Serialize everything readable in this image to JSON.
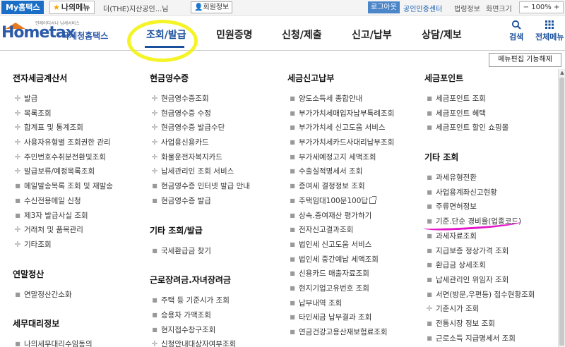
{
  "topbar": {
    "my_home": "My홈택스",
    "my_menu": "나의메뉴",
    "user_name": "더(THE)지산공인...님",
    "member_info": "회원정보",
    "logout": "로그아웃",
    "cert_center": "공인인증센터",
    "law_info": "법령정보",
    "screen_size": "화면크기",
    "zoom": "100%"
  },
  "header": {
    "logo_small": "언제어디서나 납세서비스",
    "logo_main": "Hometax",
    "logo_kr": "국세청홈택스",
    "nav": [
      "조회/발급",
      "민원증명",
      "신청/제출",
      "신고/납부",
      "상담/제보"
    ],
    "active_nav": "조회/발급",
    "search_label": "검색",
    "all_menu_label": "전체메뉴"
  },
  "menu_edit_label": "메뉴편집 기능해제",
  "columns": {
    "c1": {
      "sections": [
        {
          "title": "전자세금계산서",
          "items": [
            {
              "label": "발급",
              "mk": "plus"
            },
            {
              "label": "목록조회",
              "mk": "plus"
            },
            {
              "label": "합계표 및 통계조회",
              "mk": "plus"
            },
            {
              "label": "사용자유형별 조회권한 관리",
              "mk": "plus"
            },
            {
              "label": "주민번호수취분전환및조회",
              "mk": "plus"
            },
            {
              "label": "발급보류/예정목록조회",
              "mk": "plus"
            },
            {
              "label": "메일발송목록 조회 및 재발송",
              "mk": "sq"
            },
            {
              "label": "수신전용메일 신청",
              "mk": "sq"
            },
            {
              "label": "제3자 발급사실 조회",
              "mk": "sq"
            },
            {
              "label": "거래처 및 품목관리",
              "mk": "plus"
            },
            {
              "label": "기타조회",
              "mk": "plus"
            }
          ]
        },
        {
          "title": "연말정산",
          "items": [
            {
              "label": "연말정산간소화",
              "mk": "sq"
            }
          ]
        },
        {
          "title": "세무대리정보",
          "items": [
            {
              "label": "나의세무대리수임동의",
              "mk": "sq"
            }
          ]
        }
      ]
    },
    "c2": {
      "sections": [
        {
          "title": "현금영수증",
          "items": [
            {
              "label": "현금영수증조회",
              "mk": "plus"
            },
            {
              "label": "현금영수증 수정",
              "mk": "plus"
            },
            {
              "label": "현금영수증 발급수단",
              "mk": "plus"
            },
            {
              "label": "사업용신용카드",
              "mk": "plus"
            },
            {
              "label": "화물운전자복지카드",
              "mk": "plus"
            },
            {
              "label": "납세관리인 조회 서비스",
              "mk": "plus"
            },
            {
              "label": "현금영수증 인터넷 발급 안내",
              "mk": "sq"
            },
            {
              "label": "현금영수증 발급",
              "mk": "sq"
            }
          ]
        },
        {
          "title": "기타 조회/발급",
          "items": [
            {
              "label": "국세환급금 찾기",
              "mk": "sq"
            }
          ]
        },
        {
          "title": "근로장려금.자녀장려금",
          "items": [
            {
              "label": "주택 등 기준시가 조회",
              "mk": "sq"
            },
            {
              "label": "승용차 가액조회",
              "mk": "sq"
            },
            {
              "label": "현지접수창구조회",
              "mk": "sq"
            },
            {
              "label": "신청안내대상자여부조회",
              "mk": "plus"
            }
          ]
        }
      ]
    },
    "c3": {
      "sections": [
        {
          "title": "세금신고납부",
          "items": [
            {
              "label": "양도소득세 종합안내",
              "mk": "sq"
            },
            {
              "label": "부가가치세매입자납부특례조회",
              "mk": "sq"
            },
            {
              "label": "부가가치세 신고도움 서비스",
              "mk": "sq"
            },
            {
              "label": "부가가치세카드사대리납부조회",
              "mk": "sq"
            },
            {
              "label": "부가세예정고지 세액조회",
              "mk": "sq"
            },
            {
              "label": "수출실적명세서 조회",
              "mk": "sq"
            },
            {
              "label": "증여세 결정정보 조회",
              "mk": "sq"
            },
            {
              "label": "주택임대100문100답",
              "mk": "sq",
              "ext": true
            },
            {
              "label": "상속.증여재산 평가하기",
              "mk": "sq"
            },
            {
              "label": "전자신고결과조회",
              "mk": "sq"
            },
            {
              "label": "법인세 신고도움 서비스",
              "mk": "sq"
            },
            {
              "label": "법인세 중간예납 세액조회",
              "mk": "sq"
            },
            {
              "label": "신용카드 매출자료조회",
              "mk": "sq"
            },
            {
              "label": "현지기업고유번호 조회",
              "mk": "sq"
            },
            {
              "label": "납부내역 조회",
              "mk": "sq"
            },
            {
              "label": "타인세금 납부결과 조회",
              "mk": "sq"
            },
            {
              "label": "연금건강고용산재보험료조회",
              "mk": "sq"
            }
          ]
        }
      ]
    },
    "c4": {
      "sections": [
        {
          "title": "세금포인트",
          "items": [
            {
              "label": "세금포인트 조회",
              "mk": "sq"
            },
            {
              "label": "세금포인트 혜택",
              "mk": "sq"
            },
            {
              "label": "세금포인트 할인 쇼핑몰",
              "mk": "sq"
            }
          ]
        },
        {
          "title": "기타 조회",
          "items": [
            {
              "label": "과세유형전환",
              "mk": "sq"
            },
            {
              "label": "사업용계좌신고현황",
              "mk": "sq"
            },
            {
              "label": "주류면허정보",
              "mk": "sq"
            },
            {
              "label": "기준.단순 경비율(업종코드)",
              "mk": "sq"
            },
            {
              "label": "과세자료조회",
              "mk": "sq"
            },
            {
              "label": "지급보증 정상가격 조회",
              "mk": "sq"
            },
            {
              "label": "환급금 상세조회",
              "mk": "sq"
            },
            {
              "label": "납세관리인 위임자 조회",
              "mk": "sq"
            },
            {
              "label": "서면(방문,우편등) 접수현황조회",
              "mk": "sq"
            },
            {
              "label": "기준시가 조회",
              "mk": "plus"
            },
            {
              "label": "전통시장 정보 조회",
              "mk": "sq"
            },
            {
              "label": "근로소득 지급명세서 조회",
              "mk": "sq"
            }
          ]
        }
      ]
    }
  },
  "colors": {
    "brand_blue": "#1a4f9c",
    "my_home_bg": "#1a6ec8",
    "highlight_yellow": "#f2f200",
    "annotation_magenta": "#e316c9"
  },
  "icons": [
    "star-icon",
    "person-icon",
    "search-icon",
    "grid-icon",
    "plus-marker-icon",
    "square-marker-icon",
    "external-link-icon"
  ]
}
